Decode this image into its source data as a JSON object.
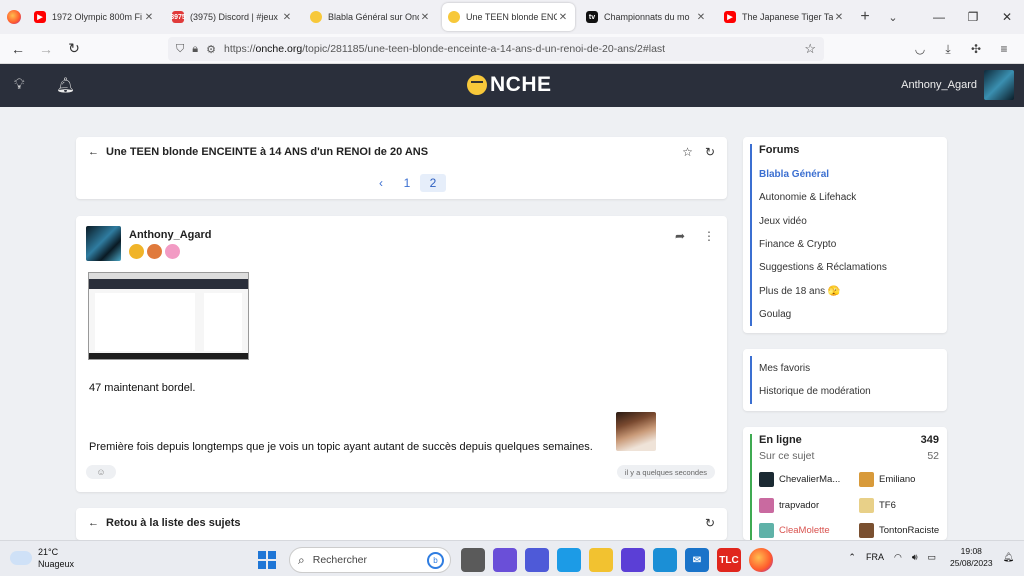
{
  "browser": {
    "tabs": [
      {
        "title": "1972 Olympic 800m Fi",
        "favicon_color": "#ff0000",
        "favicon_text": "▶",
        "active": false
      },
      {
        "title": "(3975) Discord | #jeux",
        "favicon_color": "#e03a3a",
        "favicon_text": "3975",
        "active": false
      },
      {
        "title": "Blabla Général sur Onc",
        "favicon_color": "#f7c83a",
        "favicon_text": "",
        "active": false
      },
      {
        "title": "Une TEEN blonde ENC",
        "favicon_color": "#f7c83a",
        "favicon_text": "",
        "active": true
      },
      {
        "title": "Championnats du mo",
        "favicon_color": "#111111",
        "favicon_text": "tv",
        "active": false
      },
      {
        "title": "The Japanese Tiger Tan",
        "favicon_color": "#ff0000",
        "favicon_text": "▶",
        "active": false
      }
    ],
    "url_prefix": "https://",
    "url_host": "onche.org",
    "url_path": "/topic/281185/une-teen-blonde-enceinte-a-14-ans-d-un-renoi-de-20-ans/2#last"
  },
  "site": {
    "logo_text": "NCHE",
    "username": "Anthony_Agard"
  },
  "topic": {
    "title": "Une TEEN blonde ENCEINTE à 14 ANS d'un RENOI de 20 ANS",
    "pages": [
      "1",
      "2"
    ],
    "current_page": "2"
  },
  "post": {
    "author": "Anthony_Agard",
    "text1": "47 maintenant bordel.",
    "text2": "Première fois depuis longtemps que je vois un topic ayant autant de succès depuis quelques semaines.",
    "time": "il y a quelques secondes"
  },
  "back_to_list": "Retou à la liste des sujets",
  "sidebar": {
    "forums_title": "Forums",
    "forums": [
      {
        "label": "Blabla Général",
        "active": true
      },
      {
        "label": "Autonomie & Lifehack",
        "active": false
      },
      {
        "label": "Jeux vidéo",
        "active": false
      },
      {
        "label": "Finance & Crypto",
        "active": false
      },
      {
        "label": "Suggestions & Réclamations",
        "active": false
      },
      {
        "label": "Plus de 18 ans 🫣",
        "active": false
      },
      {
        "label": "Goulag",
        "active": false
      }
    ],
    "links": [
      "Mes favoris",
      "Historique de modération"
    ],
    "online_title": "En ligne",
    "online_count": "349",
    "online_sub": "Sur ce sujet",
    "online_sub_count": "52",
    "users": [
      {
        "name": "ChevalierMa...",
        "red": false
      },
      {
        "name": "Emiliano",
        "red": false
      },
      {
        "name": "trapvador",
        "red": false
      },
      {
        "name": "TF6",
        "red": false
      },
      {
        "name": "CleaMolette",
        "red": true
      },
      {
        "name": "TontonRaciste",
        "red": false
      }
    ]
  },
  "taskbar": {
    "temp": "21°C",
    "weather": "Nuageux",
    "search_placeholder": "Rechercher",
    "lang": "FRA",
    "time": "19:08",
    "date": "25/08/2023"
  }
}
